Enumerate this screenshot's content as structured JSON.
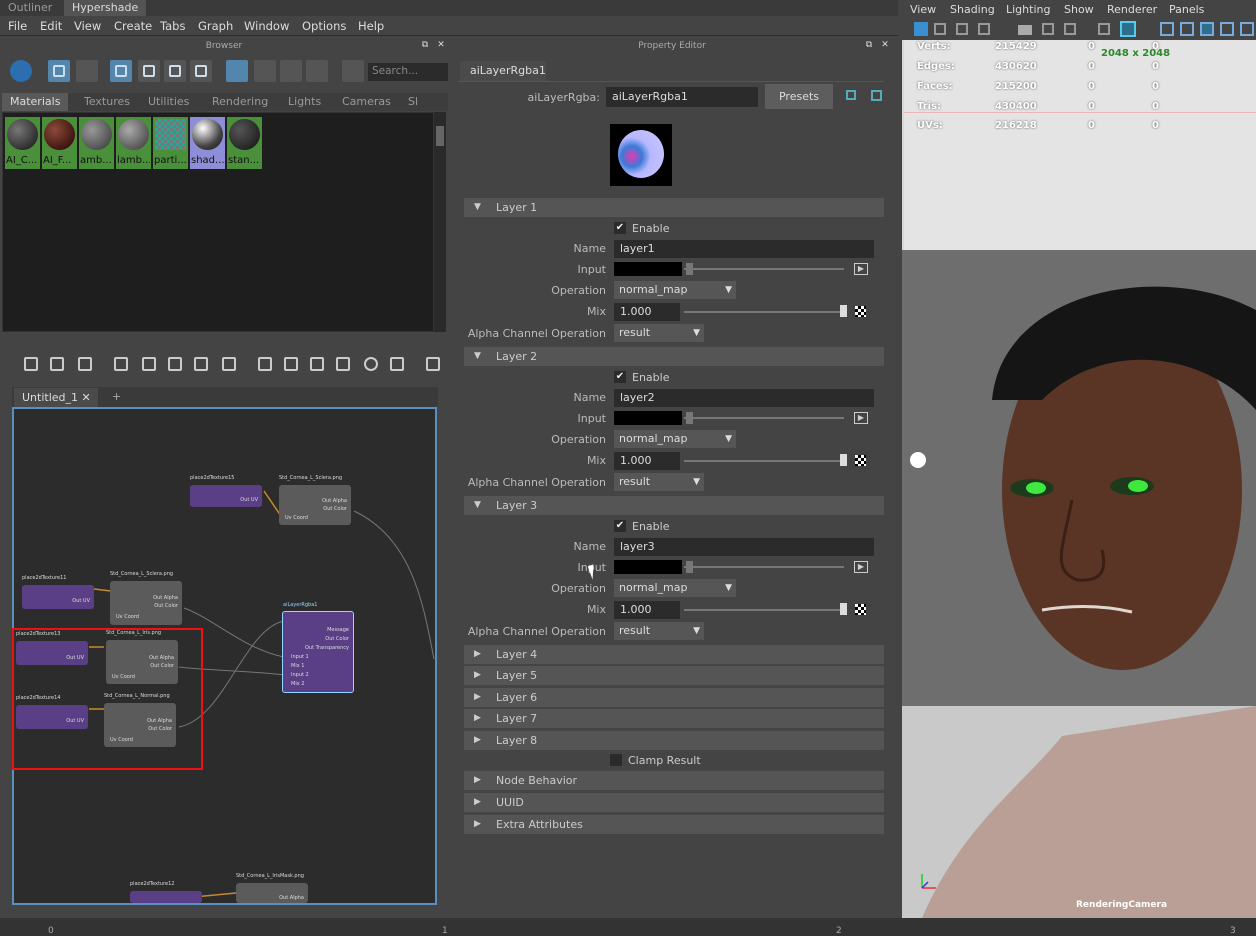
{
  "top_tabs": [
    "Outliner",
    "Hypershade"
  ],
  "menu": [
    "File",
    "Edit",
    "View",
    "Create",
    "Tabs",
    "Graph",
    "Window",
    "Options",
    "Help"
  ],
  "browser": {
    "title": "Browser",
    "search_placeholder": "Search...",
    "tabs": [
      "Materials",
      "Textures",
      "Utilities",
      "Rendering",
      "Lights",
      "Cameras",
      "Sl"
    ],
    "materials": [
      {
        "label": "AI_C...",
        "color": "#3a3a3a"
      },
      {
        "label": "AI_F...",
        "color": "#4a2a22"
      },
      {
        "label": "amb...",
        "color": "#6a6a6a"
      },
      {
        "label": "lamb...",
        "color": "#707070"
      },
      {
        "label": "parti...",
        "color": "#3a8a8a"
      },
      {
        "label": "shad...",
        "color": "#aaaaaa"
      },
      {
        "label": "stan...",
        "color": "#333333"
      }
    ]
  },
  "node_editor": {
    "tab": "Untitled_1",
    "add": "+",
    "nodes": {
      "p15": "place2dTexture15",
      "p15out": "Out UV",
      "sclera": "Std_Cornea_L_Sclera.png",
      "scl_a": "Out Alpha",
      "scl_c": "Out Color",
      "scl_uv": "Uv Coord",
      "p11": "place2dTexture11",
      "p11out": "Out UV",
      "scl2": "Std_Cornea_L_Sclera.png",
      "scl2_a": "Out Alpha",
      "scl2_c": "Out Color",
      "scl2_uv": "Uv Coord",
      "p13": "place2dTexture13",
      "p13out": "Out UV",
      "iris": "Std_Cornea_L_Iris.png",
      "iris_a": "Out Alpha",
      "iris_c": "Out Color",
      "iris_uv": "Uv Coord",
      "p14": "place2dTexture14",
      "p14out": "Out UV",
      "normal": "Std_Cornea_L_Normal.png",
      "norm_a": "Out Alpha",
      "norm_c": "Out Color",
      "norm_uv": "Uv Coord",
      "layer": "aiLayerRgba1",
      "l_msg": "Message",
      "l_c": "Out Color",
      "l_t": "Out Transparency",
      "l_i1": "Input 1",
      "l_m1": "Mix 1",
      "l_i2": "Input 2",
      "l_m2": "Mix 2",
      "p12": "place2dTexture12",
      "mask": "Std_Cornea_L_IrisMask.png",
      "mask_a": "Out Alpha"
    }
  },
  "property_editor": {
    "title": "Property Editor",
    "tab": "aiLayerRgba1",
    "type_label": "aiLayerRgba:",
    "node_name": "aiLayerRgba1",
    "presets": "Presets",
    "enable": "Enable",
    "name_label": "Name",
    "input_label": "Input",
    "operation_label": "Operation",
    "mix_label": "Mix",
    "alpha_label": "Alpha Channel Operation",
    "layers": [
      {
        "title": "Layer 1",
        "name": "layer1",
        "operation": "normal_map",
        "mix": "1.000",
        "alpha": "result"
      },
      {
        "title": "Layer 2",
        "name": "layer2",
        "operation": "normal_map",
        "mix": "1.000",
        "alpha": "result"
      },
      {
        "title": "Layer 3",
        "name": "layer3",
        "operation": "normal_map",
        "mix": "1.000",
        "alpha": "result"
      }
    ],
    "collapsed": [
      "Layer 4",
      "Layer 5",
      "Layer 6",
      "Layer 7",
      "Layer 8"
    ],
    "clamp": "Clamp Result",
    "sections": [
      "Node Behavior",
      "UUID",
      "Extra Attributes"
    ]
  },
  "viewport": {
    "menu": [
      "View",
      "Shading",
      "Lighting",
      "Show",
      "Renderer",
      "Panels"
    ],
    "hud": [
      {
        "k": "Verts:",
        "a": "215429",
        "b": "0",
        "c": "0"
      },
      {
        "k": "Edges:",
        "a": "430620",
        "b": "0",
        "c": "0"
      },
      {
        "k": "Faces:",
        "a": "215200",
        "b": "0",
        "c": "0"
      },
      {
        "k": "Tris:",
        "a": "430400",
        "b": "0",
        "c": "0"
      },
      {
        "k": "UVs:",
        "a": "216218",
        "b": "0",
        "c": "0"
      }
    ],
    "resolution": "2048 x 2048",
    "camera": "RenderingCamera"
  },
  "timeline": [
    "0",
    "1",
    "2",
    "3"
  ]
}
